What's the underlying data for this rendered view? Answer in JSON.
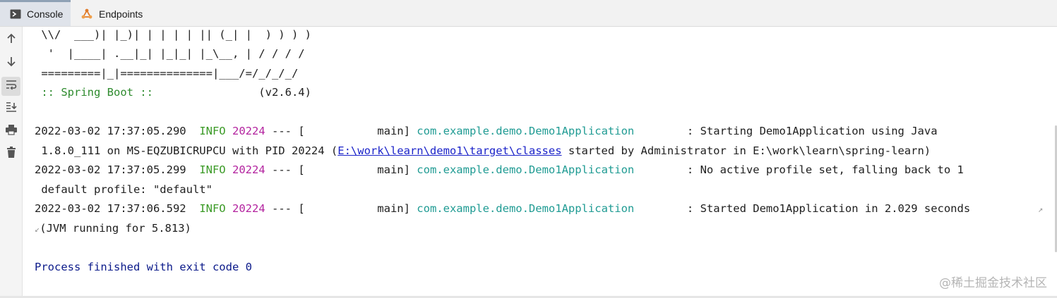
{
  "tabs": {
    "console_label": "Console",
    "endpoints_label": "Endpoints"
  },
  "toolbar": {
    "icons": [
      "up-arrow-icon",
      "down-arrow-icon",
      "soft-wrap-icon",
      "scroll-to-end-icon",
      "print-icon",
      "trash-icon"
    ]
  },
  "banner": {
    "line1": " \\\\/  ___)| |_)| | | | | || (_| |  ) ) ) )",
    "line2": "  '  |____| .__|_| |_|_| |_\\__, | / / / /",
    "line3": " =========|_|==============|___/=/_/_/_/",
    "spring": " :: Spring Boot :: ",
    "version": "               (v2.6.4)"
  },
  "log": [
    {
      "timestamp": "2022-03-02 17:37:05.290",
      "level": "INFO",
      "pid": "20224",
      "sep": " --- [           main] ",
      "logger": "com.example.demo.Demo1Application",
      "pad": "        : ",
      "message": "Starting Demo1Application using Java",
      "cont_pre": " 1.8.0_111 on MS-EQZUBICRUPCU with PID 20224 (",
      "cont_link": "E:\\work\\learn\\demo1\\target\\classes",
      "cont_post": " started by Administrator in E:\\work\\learn\\spring-learn)"
    },
    {
      "timestamp": "2022-03-02 17:37:05.299",
      "level": "INFO",
      "pid": "20224",
      "sep": " --- [           main] ",
      "logger": "com.example.demo.Demo1Application",
      "pad": "        : ",
      "message": "No active profile set, falling back to 1",
      "cont": " default profile: \"default\""
    },
    {
      "timestamp": "2022-03-02 17:37:06.592",
      "level": "INFO",
      "pid": "20224",
      "sep": " --- [           main] ",
      "logger": "com.example.demo.Demo1Application",
      "pad": "        : ",
      "message": "Started Demo1Application in 2.029 seconds",
      "cont": "(JVM running for 5.813)"
    }
  ],
  "process_exit": "Process finished with exit code 0",
  "watermark": "@稀土掘金技术社区",
  "colors": {
    "info": "#3a9a25",
    "pid": "#b3239f",
    "logger": "#1f9b93",
    "link": "#1b23c9",
    "exit": "#0b1a8a"
  }
}
